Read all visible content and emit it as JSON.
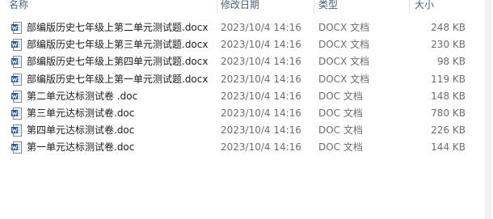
{
  "columns": {
    "name": "名称",
    "date": "修改日期",
    "type": "类型",
    "size": "大小"
  },
  "files": [
    {
      "name": "部编版历史七年级上第二单元测试题.docx",
      "date": "2023/10/4 14:16",
      "type": "DOCX 文档",
      "size": "248 KB",
      "icon": "word-docx-icon"
    },
    {
      "name": "部编版历史七年级上第三单元测试题.docx",
      "date": "2023/10/4 14:16",
      "type": "DOCX 文档",
      "size": "230 KB",
      "icon": "word-docx-icon"
    },
    {
      "name": "部编版历史七年级上第四单元测试题.docx",
      "date": "2023/10/4 14:16",
      "type": "DOCX 文档",
      "size": "98 KB",
      "icon": "word-docx-icon"
    },
    {
      "name": "部编版历史七年级上第一单元测试题.docx",
      "date": "2023/10/4 14:16",
      "type": "DOCX 文档",
      "size": "119 KB",
      "icon": "word-docx-icon"
    },
    {
      "name": "第二单元达标测试卷 .doc",
      "date": "2023/10/4 14:16",
      "type": "DOC 文档",
      "size": "148 KB",
      "icon": "word-doc-icon"
    },
    {
      "name": "第三单元达标测试卷.doc",
      "date": "2023/10/4 14:16",
      "type": "DOC 文档",
      "size": "780 KB",
      "icon": "word-doc-icon"
    },
    {
      "name": "第四单元达标测试卷.doc",
      "date": "2023/10/4 14:16",
      "type": "DOC 文档",
      "size": "226 KB",
      "icon": "word-doc-icon"
    },
    {
      "name": "第一单元达标测试卷.doc",
      "date": "2023/10/4 14:16",
      "type": "DOC 文档",
      "size": "144 KB",
      "icon": "word-doc-icon"
    }
  ],
  "colors": {
    "header_text": "#4c607a",
    "icon_blue": "#2b5797"
  }
}
